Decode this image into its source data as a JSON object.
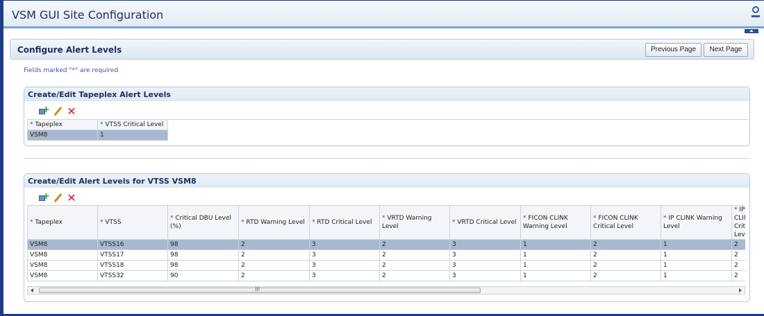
{
  "app": {
    "title": "VSM GUI Site Configuration"
  },
  "page": {
    "title": "Configure Alert Levels",
    "prev_label": "Previous Page",
    "next_label": "Next Page",
    "required_note": "Fields marked \"*\" are required"
  },
  "tapeplex_panel": {
    "title": "Create/Edit Tapeplex Alert Levels",
    "headers": [
      "Tapeplex",
      "VTSS Critical Level"
    ],
    "rows": [
      [
        "VSM8",
        "1"
      ]
    ]
  },
  "vtss_panel": {
    "title": "Create/Edit Alert Levels for VTSS VSM8",
    "headers": [
      "Tapeplex",
      "VTSS",
      "Critical DBU Level (%)",
      "RTD Warning Level",
      "RTD Critical Level",
      "VRTD Warning Level",
      "VRTD Critical Level",
      "FICON CLINK Warning Level",
      "FICON CLINK Critical Level",
      "IP CLINK Warning Level",
      "IP CLINK Critical Level"
    ],
    "rows": [
      [
        "VSM8",
        "VTSS16",
        "98",
        "2",
        "3",
        "2",
        "3",
        "1",
        "2",
        "1",
        "2"
      ],
      [
        "VSM8",
        "VTSS17",
        "98",
        "2",
        "3",
        "2",
        "3",
        "1",
        "2",
        "1",
        "2"
      ],
      [
        "VSM8",
        "VTSS18",
        "98",
        "2",
        "3",
        "2",
        "3",
        "1",
        "2",
        "1",
        "2"
      ],
      [
        "VSM8",
        "VTSS32",
        "90",
        "2",
        "3",
        "2",
        "3",
        "1",
        "2",
        "1",
        "2"
      ]
    ],
    "scroll_grip": "III"
  },
  "icons": {
    "create": "create-icon",
    "edit": "edit-icon",
    "delete": "delete-icon",
    "user": "user-icon"
  }
}
